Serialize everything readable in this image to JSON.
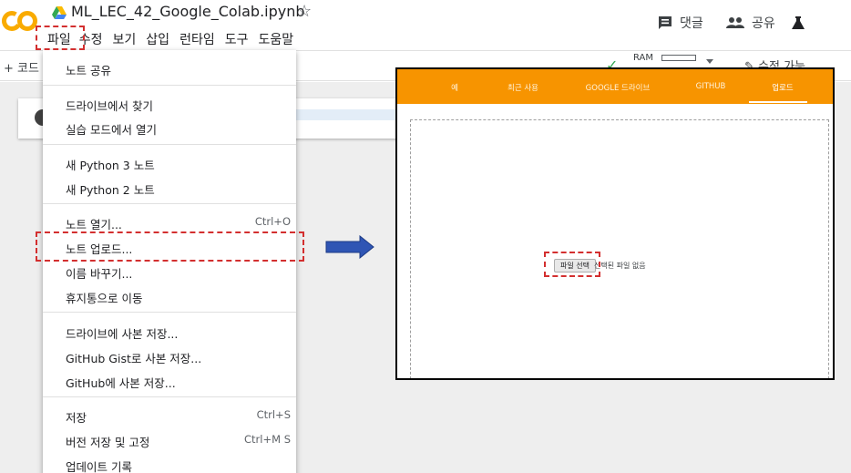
{
  "app": {
    "title": "ML_LEC_42_Google_Colab.ipynb",
    "logo_text": "CO",
    "logo_color": "#f9ab00"
  },
  "menubar": [
    "파일",
    "수정",
    "보기",
    "삽입",
    "런타임",
    "도구",
    "도움말"
  ],
  "header_actions": {
    "comment": "댓글",
    "share": "공유"
  },
  "toolbar": {
    "add_code": "+ 코드",
    "ram_label": "RAM",
    "edit_status": "수정 가능"
  },
  "file_menu": {
    "items": [
      {
        "label": "노트 공유",
        "shortcut": ""
      },
      {
        "label": "드라이브에서 찾기",
        "shortcut": ""
      },
      {
        "label": "실습 모드에서 열기",
        "shortcut": ""
      },
      {
        "label": "새 Python 3 노트",
        "shortcut": ""
      },
      {
        "label": "새 Python 2 노트",
        "shortcut": ""
      },
      {
        "label": "노트 열기...",
        "shortcut": "Ctrl+O"
      },
      {
        "label": "노트 업로드...",
        "shortcut": ""
      },
      {
        "label": "이름 바꾸기...",
        "shortcut": ""
      },
      {
        "label": "휴지통으로 이동",
        "shortcut": ""
      },
      {
        "label": "드라이브에 사본 저장...",
        "shortcut": ""
      },
      {
        "label": "GitHub Gist로 사본 저장...",
        "shortcut": ""
      },
      {
        "label": "GitHub에 사본 저장...",
        "shortcut": ""
      },
      {
        "label": "저장",
        "shortcut": "Ctrl+S"
      },
      {
        "label": "버전 저장 및 고정",
        "shortcut": "Ctrl+M S"
      },
      {
        "label": "업데이트 기록",
        "shortcut": ""
      }
    ]
  },
  "upload_dialog": {
    "tabs": [
      "예",
      "최근 사용",
      "GOOGLE 드라이브",
      "GITHUB",
      "업로드"
    ],
    "active_tab": "업로드",
    "header_color": "#f79400",
    "choose_file_button": "파일 선택",
    "no_file_text": "선택된 파일 없음"
  },
  "colors": {
    "annotation": "#d32f2f",
    "arrow": "#2f55b4"
  }
}
